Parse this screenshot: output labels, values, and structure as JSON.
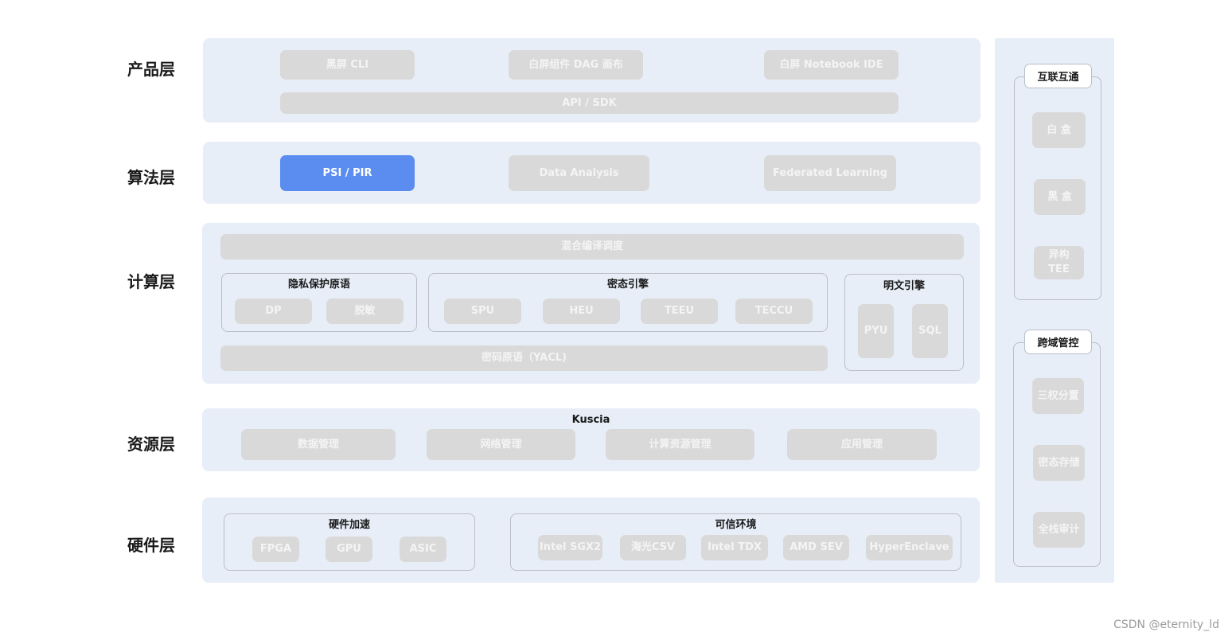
{
  "layers": {
    "product": "产品层",
    "algorithm": "算法层",
    "compute": "计算层",
    "resource": "资源层",
    "hardware": "硬件层"
  },
  "product": {
    "cli": "黑屏 CLI",
    "dag": "白屏组件 DAG 画布",
    "notebook": "白屏 Notebook IDE",
    "api": "API / SDK"
  },
  "algorithm": {
    "psi": "PSI / PIR",
    "data_analysis": "Data Analysis",
    "fl": "Federated Learning"
  },
  "compute": {
    "hybrid": "混合编译调度",
    "privacy_group": {
      "title": "隐私保护原语",
      "dp": "DP",
      "desens": "脱敏"
    },
    "cipher_group": {
      "title": "密态引擎",
      "spu": "SPU",
      "heu": "HEU",
      "teeu": "TEEU",
      "teccu": "TECCU"
    },
    "yacl": "密码原语（YACL)",
    "plain_group": {
      "title": "明文引擎",
      "pyu": "PYU",
      "sql": "SQL"
    }
  },
  "resource": {
    "title": "Kuscia",
    "data_mgmt": "数据管理",
    "net_mgmt": "网络管理",
    "compute_mgmt": "计算资源管理",
    "app_mgmt": "应用管理"
  },
  "hardware": {
    "accel": {
      "title": "硬件加速",
      "fpga": "FPGA",
      "gpu": "GPU",
      "asic": "ASIC"
    },
    "trust": {
      "title": "可信环境",
      "sgx2": "Intel SGX2",
      "csv": "海光CSV",
      "tdx": "Intel TDX",
      "sev": "AMD SEV",
      "hyper": "HyperEnclave"
    }
  },
  "sidebar": {
    "interop": {
      "title": "互联互通",
      "white": "白 盒",
      "black": "黑 盒",
      "tee_line1": "异构",
      "tee_line2": "TEE"
    },
    "crossdomain": {
      "title": "跨域管控",
      "separation": "三权分置",
      "storage": "密态存储",
      "audit": "全栈审计"
    }
  },
  "watermark": "CSDN @eternity_ld",
  "colors": {
    "panel": "#e8eef8",
    "chip": "#d9d9d9",
    "chip_text": "#f4f4f4",
    "accent": "#5b8df0",
    "border": "#b9bec7"
  }
}
